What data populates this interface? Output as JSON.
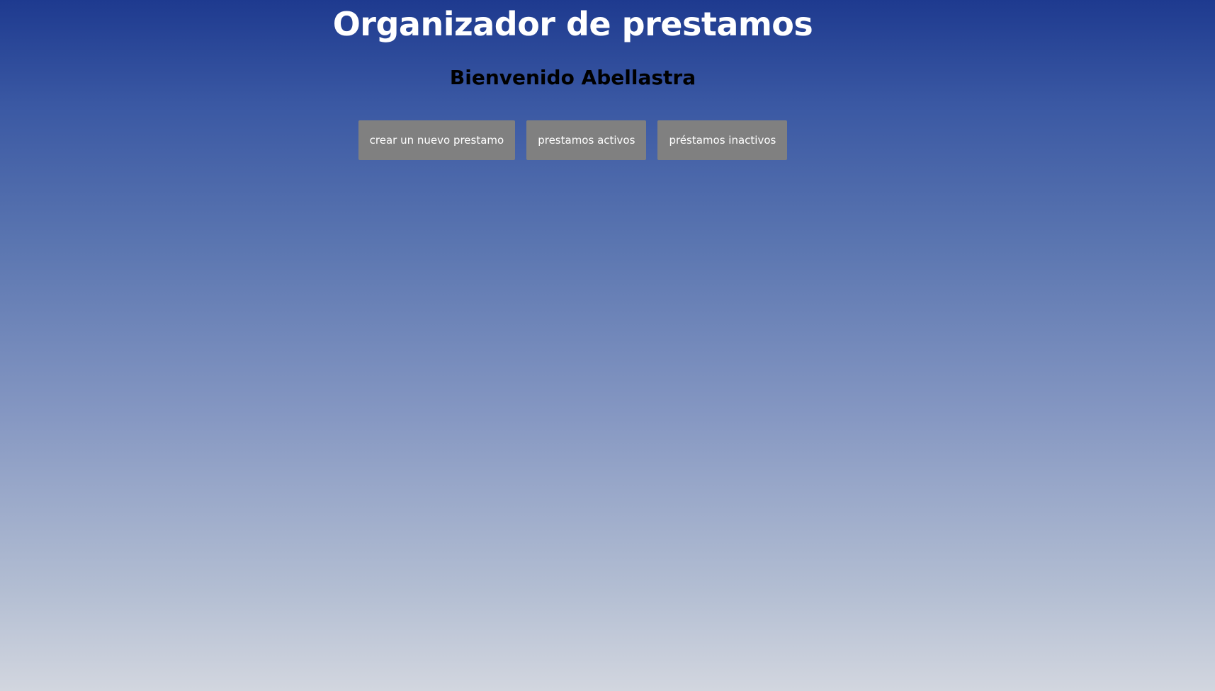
{
  "header": {
    "title": "Organizador de prestamos",
    "welcome": "Bienvenido Abellastra"
  },
  "actions": {
    "create_label": "crear un nuevo prestamo",
    "active_label": "prestamos activos",
    "inactive_label": "préstamos inactivos"
  },
  "colors": {
    "button_bg": "#808080",
    "button_text": "#ffffff",
    "title_text": "#ffffff",
    "welcome_text": "#000000",
    "gradient_top": "#1e3a8f",
    "gradient_bottom": "#d2d6df"
  }
}
